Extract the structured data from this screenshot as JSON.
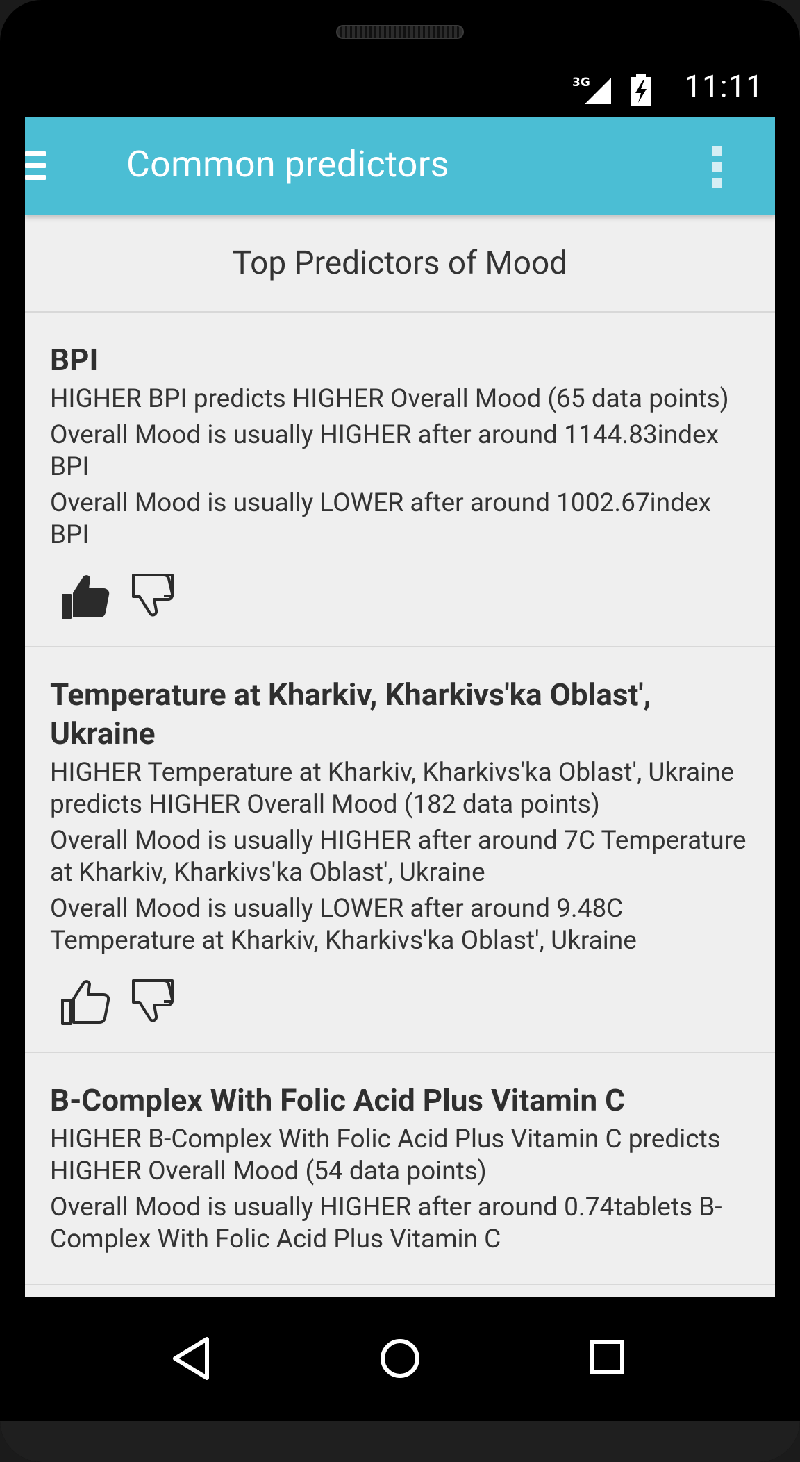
{
  "status_bar": {
    "network": "3G",
    "time": "11:11"
  },
  "app_bar": {
    "title": "Common predictors",
    "menu_icon": "hamburger-menu-icon",
    "overflow_icon": "more-vert-icon"
  },
  "header": {
    "title": "Top Predictors of Mood"
  },
  "predictors": [
    {
      "title": "BPI",
      "lines": [
        "HIGHER BPI predicts HIGHER Overall Mood (65 data points)",
        "Overall Mood is usually HIGHER after around 1144.83index BPI",
        "Overall Mood is usually LOWER after around 1002.67index BPI"
      ],
      "thumbs_up_active": true,
      "thumbs_down_active": false
    },
    {
      "title": "Temperature at Kharkiv, Kharkivs'ka Oblast', Ukraine",
      "lines": [
        "HIGHER Temperature at Kharkiv, Kharkivs'ka Oblast', Ukraine predicts HIGHER Overall Mood (182 data points)",
        "Overall Mood is usually HIGHER after around 7C Temperature at Kharkiv, Kharkivs'ka Oblast', Ukraine",
        "Overall Mood is usually LOWER after around 9.48C Temperature at Kharkiv, Kharkivs'ka Oblast', Ukraine"
      ],
      "thumbs_up_active": false,
      "thumbs_down_active": false
    },
    {
      "title": "B-Complex With Folic Acid Plus Vitamin C",
      "lines": [
        "HIGHER B-Complex With Folic Acid Plus Vitamin C predicts HIGHER Overall Mood (54 data points)",
        "Overall Mood is usually HIGHER after around 0.74tablets B-Complex With Folic Acid Plus Vitamin C"
      ],
      "thumbs_up_active": false,
      "thumbs_down_active": false
    }
  ],
  "nav_bar": {
    "back_icon": "back-icon",
    "home_icon": "home-icon",
    "recents_icon": "recents-icon"
  },
  "colors": {
    "app_bar": "#4bbed4",
    "background": "#efefef",
    "text": "#333333"
  }
}
